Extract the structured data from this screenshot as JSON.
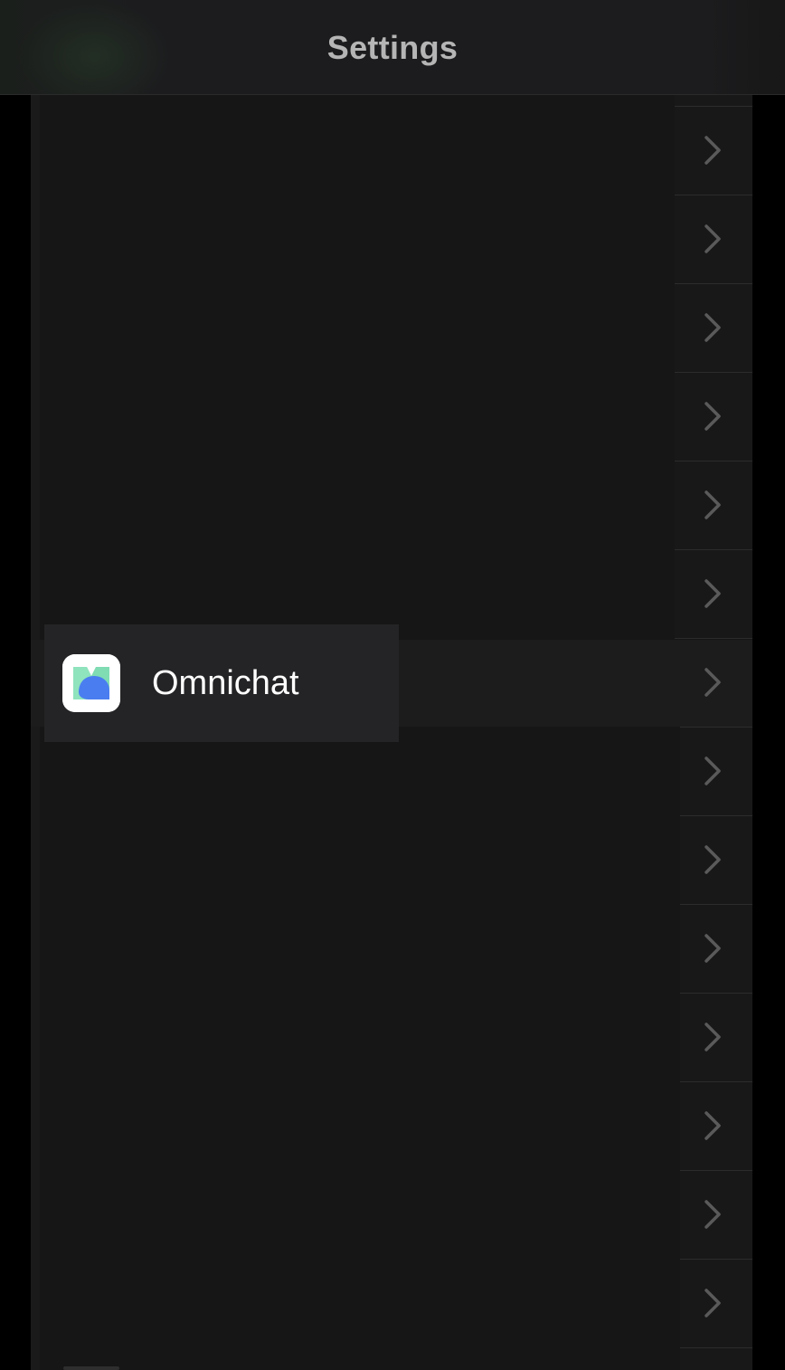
{
  "nav": {
    "title": "Settings"
  },
  "dragged_item": {
    "label": "Omnichat",
    "icon": "omnichat-app-icon"
  },
  "rows": [
    {
      "chevron": "chevron-right-icon"
    },
    {
      "chevron": "chevron-right-icon"
    },
    {
      "chevron": "chevron-right-icon"
    },
    {
      "chevron": "chevron-right-icon"
    },
    {
      "chevron": "chevron-right-icon"
    },
    {
      "chevron": "chevron-right-icon"
    },
    {
      "chevron": "chevron-right-icon"
    },
    {
      "chevron": "chevron-right-icon"
    },
    {
      "chevron": "chevron-right-icon"
    },
    {
      "chevron": "chevron-right-icon"
    },
    {
      "chevron": "chevron-right-icon"
    },
    {
      "chevron": "chevron-right-icon"
    },
    {
      "chevron": "chevron-right-icon"
    },
    {
      "chevron": "chevron-right-icon"
    }
  ],
  "colors": {
    "background": "#000000",
    "list": "#161616",
    "title": "#b5b5b5",
    "chevron": "#5a5a5a",
    "icon_green": "#6fd6a8",
    "icon_blue": "#4a7ef0"
  }
}
